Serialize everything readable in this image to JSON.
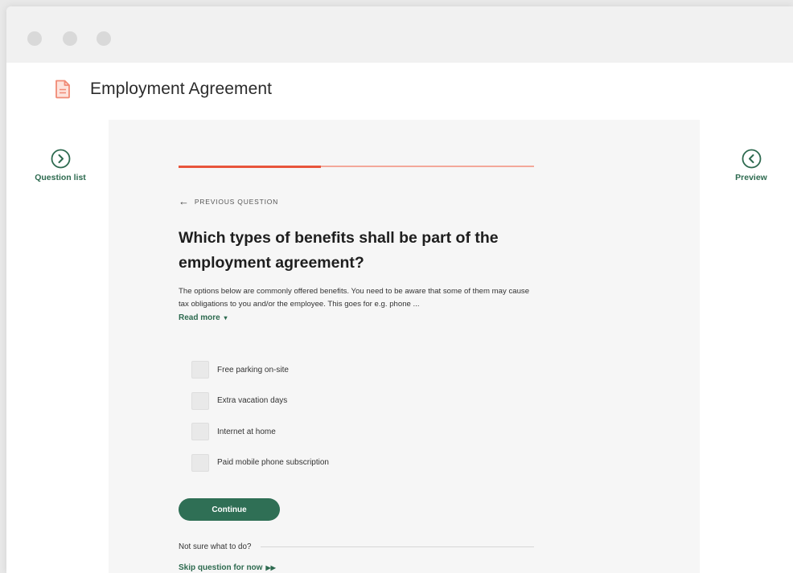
{
  "document": {
    "title": "Employment Agreement"
  },
  "side_nav": {
    "left_label": "Question list",
    "right_label": "Preview"
  },
  "progress": {
    "fraction": 0.4
  },
  "question": {
    "previous_label": "PREVIOUS QUESTION",
    "title": "Which types of benefits shall be part of the employment agreement?",
    "description": "The options below are commonly offered benefits. You need to be aware that some of them may cause tax obligations to you and/or the employee. This goes for e.g. phone ...",
    "read_more": "Read more",
    "options": [
      {
        "label": "Free parking on-site",
        "checked": false
      },
      {
        "label": "Extra vacation days",
        "checked": false
      },
      {
        "label": "Internet at home",
        "checked": false
      },
      {
        "label": "Paid mobile phone subscription",
        "checked": false
      }
    ]
  },
  "actions": {
    "continue_label": "Continue",
    "not_sure_text": "Not sure what to do?",
    "skip_label": "Skip question for now"
  },
  "colors": {
    "accent_green": "#2f6f55",
    "progress_red": "#e8553b",
    "doc_icon": "#f08a75"
  }
}
